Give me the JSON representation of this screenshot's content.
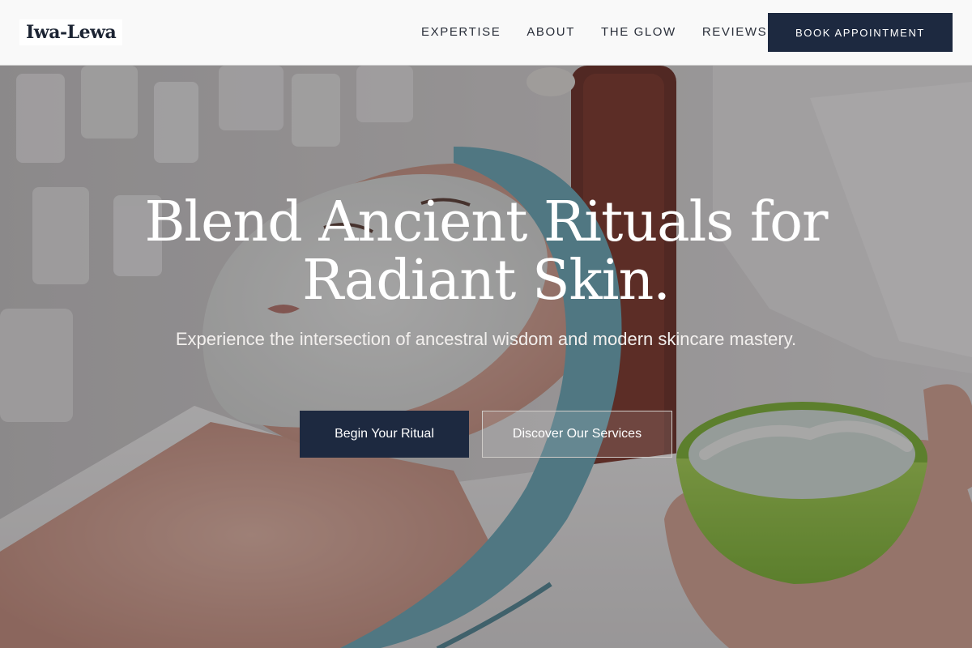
{
  "brand": {
    "name": "Iwa-Lewa"
  },
  "nav": {
    "items": [
      {
        "label": "EXPERTISE"
      },
      {
        "label": "ABOUT"
      },
      {
        "label": "THE GLOW"
      },
      {
        "label": "REVIEWS"
      }
    ],
    "cta_label": "BOOK APPOINTMENT"
  },
  "hero": {
    "title_line1": "Blend Ancient Rituals for",
    "title_line2": "Radiant Skin.",
    "subtitle": "Experience the intersection of ancestral wisdom and modern skincare mastery.",
    "primary_button": "Begin Your Ritual",
    "secondary_button": "Discover Our Services"
  },
  "colors": {
    "accent_navy": "#1d2940",
    "header_bg": "#f9f9f9",
    "bowl_green": "#8cc63f",
    "headband_teal": "#6aaab8"
  },
  "icons": {
    "hero_photo": "facial-treatment-photo"
  }
}
